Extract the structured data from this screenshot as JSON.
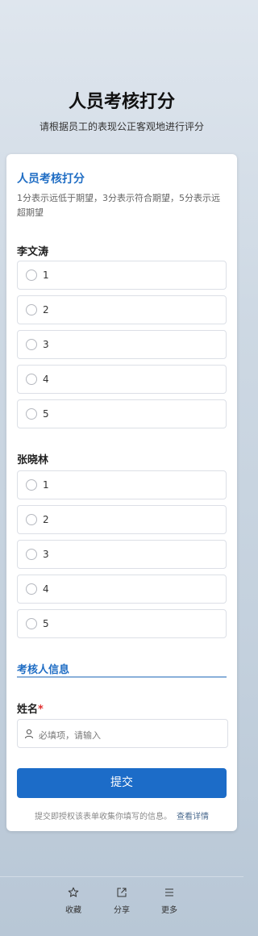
{
  "header": {
    "title": "人员考核打分",
    "subtitle": "请根据员工的表现公正客观地进行评分"
  },
  "form": {
    "section_title": "人员考核打分",
    "section_desc": "1分表示远低于期望，3分表示符合期望，5分表示远超期望",
    "questions": [
      {
        "name": "李文涛",
        "options": [
          "1",
          "2",
          "3",
          "4",
          "5"
        ]
      },
      {
        "name": "张晓林",
        "options": [
          "1",
          "2",
          "3",
          "4",
          "5"
        ]
      }
    ],
    "info_heading": "考核人信息",
    "name_field": {
      "label": "姓名",
      "required_mark": "*",
      "placeholder": "必填项，请输入"
    },
    "submit_label": "提交",
    "consent_text": "提交即授权该表单收集你填写的信息。",
    "consent_link": "查看详情"
  },
  "bottom_bar": {
    "items": [
      {
        "label": "收藏",
        "icon": "star-icon"
      },
      {
        "label": "分享",
        "icon": "share-icon"
      },
      {
        "label": "更多",
        "icon": "menu-icon"
      }
    ]
  }
}
